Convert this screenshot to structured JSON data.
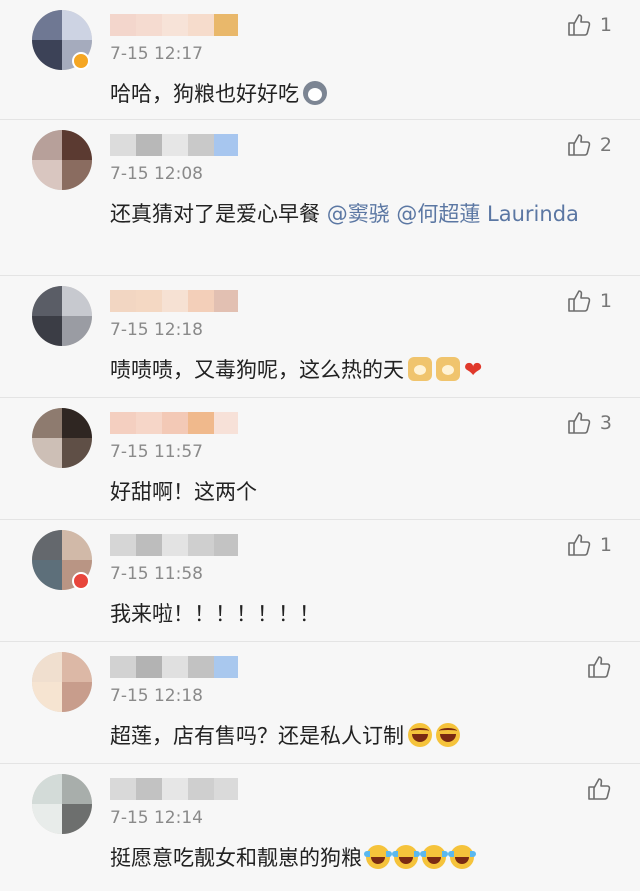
{
  "comments": [
    {
      "time": "7-15 12:17",
      "likes": "1",
      "verified": true,
      "verify_color": "#f5a623",
      "segments": [
        {
          "type": "text",
          "value": "哈哈，狗粮也好好吃"
        },
        {
          "type": "emoji",
          "icon": "dog-face-emoji"
        }
      ]
    },
    {
      "time": "7-15 12:08",
      "likes": "2",
      "verified": false,
      "segments": [
        {
          "type": "text",
          "value": "还真猜对了是爱心早餐 "
        },
        {
          "type": "mention",
          "value": "@窦骁"
        },
        {
          "type": "text",
          "value": " "
        },
        {
          "type": "mention",
          "value": "@何超蓮 Laurinda"
        }
      ]
    },
    {
      "time": "7-15 12:18",
      "likes": "1",
      "verified": false,
      "segments": [
        {
          "type": "text",
          "value": "啧啧啧，又毒狗呢，这么热的天"
        },
        {
          "type": "emoji",
          "icon": "doge-emoji"
        },
        {
          "type": "emoji",
          "icon": "doge-emoji"
        },
        {
          "type": "emoji",
          "icon": "heart-emoji"
        }
      ]
    },
    {
      "time": "7-15 11:57",
      "likes": "3",
      "verified": false,
      "segments": [
        {
          "type": "text",
          "value": "好甜啊！这两个"
        }
      ]
    },
    {
      "time": "7-15 11:58",
      "likes": "1",
      "verified": true,
      "verify_color": "#e8463c",
      "segments": [
        {
          "type": "text",
          "value": "我来啦！！！！！！！"
        }
      ]
    },
    {
      "time": "7-15 12:18",
      "likes": "",
      "verified": false,
      "segments": [
        {
          "type": "text",
          "value": "超莲，店有售吗？还是私人订制"
        },
        {
          "type": "emoji",
          "icon": "laugh-emoji"
        },
        {
          "type": "emoji",
          "icon": "laugh-emoji"
        }
      ]
    },
    {
      "time": "7-15 12:14",
      "likes": "",
      "verified": false,
      "segments": [
        {
          "type": "text",
          "value": "挺愿意吃靓女和靓崽的狗粮"
        },
        {
          "type": "emoji",
          "icon": "laugh-cry-emoji"
        },
        {
          "type": "emoji",
          "icon": "laugh-cry-emoji"
        },
        {
          "type": "emoji",
          "icon": "laugh-cry-emoji"
        },
        {
          "type": "emoji",
          "icon": "laugh-cry-emoji"
        }
      ]
    }
  ],
  "colors": {
    "background": "#f7f7f7",
    "mention": "#5b77a3",
    "time": "#8a8a8a",
    "divider": "#e4e4e4"
  }
}
